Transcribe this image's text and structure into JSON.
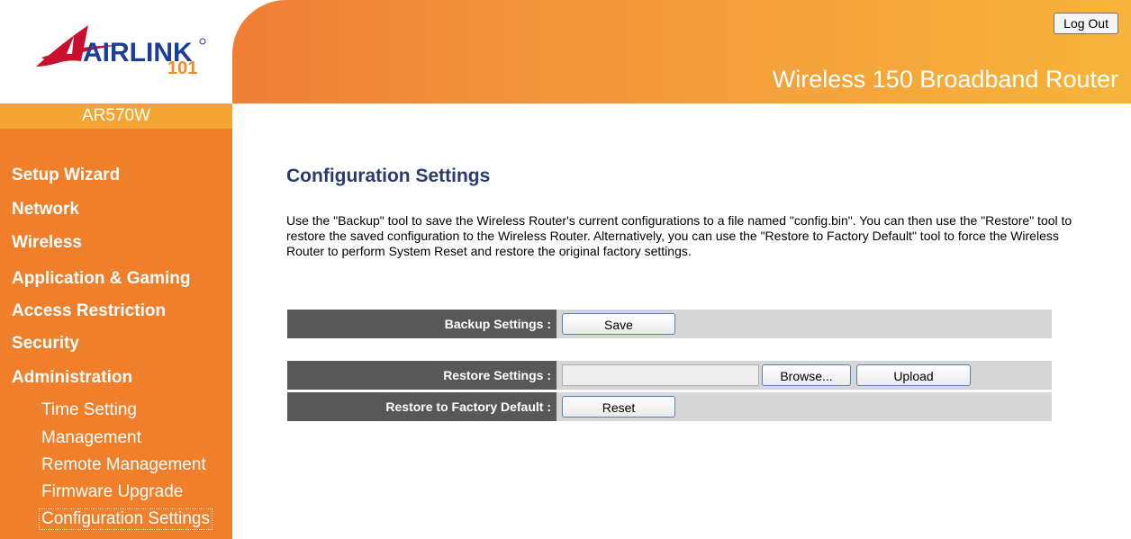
{
  "brand": {
    "logo_text": "AIRLINK",
    "logo_number": "101",
    "model": "AR570W"
  },
  "header": {
    "logout_label": "Log Out",
    "product_title": "Wireless 150 Broadband Router"
  },
  "sidebar": {
    "main_items": [
      {
        "label": "Setup Wizard"
      },
      {
        "label": "Network"
      },
      {
        "label": "Wireless"
      },
      {
        "label": "Application & Gaming"
      },
      {
        "label": "Access Restriction"
      },
      {
        "label": "Security"
      },
      {
        "label": "Administration"
      }
    ],
    "sub_items": [
      {
        "label": "Time Setting"
      },
      {
        "label": "Management"
      },
      {
        "label": "Remote Management"
      },
      {
        "label": "Firmware Upgrade"
      },
      {
        "label": "Configuration Settings"
      }
    ]
  },
  "main": {
    "title": "Configuration Settings",
    "description": "Use the \"Backup\" tool to save the Wireless Router's current configurations to a file named \"config.bin\". You can then use the \"Restore\" tool to restore the saved configuration to the Wireless Router. Alternatively, you can use the \"Restore to Factory Default\" tool to force the Wireless Router to perform System Reset and restore the original factory settings.",
    "backup": {
      "label": "Backup Settings :",
      "button": "Save"
    },
    "restore": {
      "label": "Restore Settings :",
      "file_value": "",
      "browse_button": "Browse...",
      "upload_button": "Upload"
    },
    "factory": {
      "label": "Restore to Factory Default :",
      "button": "Reset"
    }
  },
  "colors": {
    "sidebar_bg": "#f07f2b",
    "model_bar": "#f5a532",
    "title_blue": "#283b6e",
    "label_bg": "#585858",
    "row_bg": "#d6d6d6",
    "logo_red": "#c8102e",
    "logo_blue": "#1c3f94",
    "logo_orange": "#f08a24"
  }
}
